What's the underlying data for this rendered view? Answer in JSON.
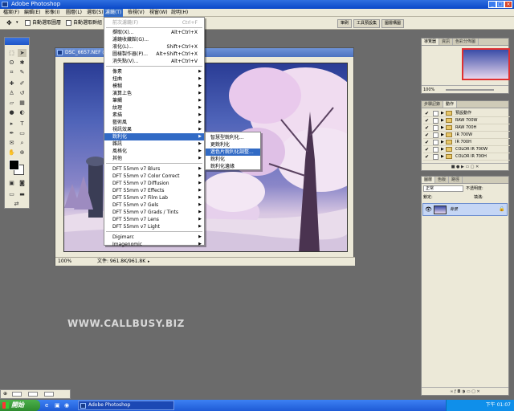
{
  "window": {
    "title": "Adobe Photoshop",
    "min_icon": "minimize-icon",
    "max_icon": "maximize-icon",
    "close_icon": "close-icon"
  },
  "menubar": {
    "items": [
      "檔案(F)",
      "編輯(E)",
      "影像(I)",
      "圖層(L)",
      "選取(S)",
      "濾鏡(T)",
      "檢視(V)",
      "視窗(W)",
      "說明(H)"
    ],
    "active_index": 5
  },
  "options": {
    "auto_select_layer": "自動選取圖層",
    "auto_select_group": "自動選取群組",
    "tabs": [
      "筆刷",
      "工具預設集",
      "圖層構圖"
    ]
  },
  "document": {
    "title": "DSC_6657.NEF @",
    "zoom": "100%",
    "file_info": "文件: 961.8K/961.8K"
  },
  "filter_menu": {
    "items": [
      {
        "label": "前次濾鏡(F)",
        "shortcut": "Ctrl+F",
        "disabled": true,
        "arrow": false
      },
      {
        "label": "擷取(X)...",
        "shortcut": "Alt+Ctrl+X",
        "disabled": false,
        "arrow": false
      },
      {
        "label": "濾鏡收藏館(G)...",
        "shortcut": "",
        "disabled": false,
        "arrow": false
      },
      {
        "label": "液化(L)...",
        "shortcut": "Shift+Ctrl+X",
        "disabled": false,
        "arrow": false
      },
      {
        "label": "圖樣製作器(P)...",
        "shortcut": "Alt+Shift+Ctrl+X",
        "disabled": false,
        "arrow": false
      },
      {
        "label": "消失點(V)...",
        "shortcut": "Alt+Ctrl+V",
        "disabled": false,
        "arrow": false
      },
      {
        "label": "像素",
        "shortcut": "",
        "disabled": false,
        "arrow": true
      },
      {
        "label": "扭曲",
        "shortcut": "",
        "disabled": false,
        "arrow": true
      },
      {
        "label": "模糊",
        "shortcut": "",
        "disabled": false,
        "arrow": true
      },
      {
        "label": "演算上色",
        "shortcut": "",
        "disabled": false,
        "arrow": true
      },
      {
        "label": "筆觸",
        "shortcut": "",
        "disabled": false,
        "arrow": true
      },
      {
        "label": "紋理",
        "shortcut": "",
        "disabled": false,
        "arrow": true
      },
      {
        "label": "素描",
        "shortcut": "",
        "disabled": false,
        "arrow": true
      },
      {
        "label": "藝術風",
        "shortcut": "",
        "disabled": false,
        "arrow": true
      },
      {
        "label": "視訊效果",
        "shortcut": "",
        "disabled": false,
        "arrow": true
      },
      {
        "label": "銳利化",
        "shortcut": "",
        "disabled": false,
        "arrow": true,
        "highlighted": true
      },
      {
        "label": "雜訊",
        "shortcut": "",
        "disabled": false,
        "arrow": true
      },
      {
        "label": "風格化",
        "shortcut": "",
        "disabled": false,
        "arrow": true
      },
      {
        "label": "其他",
        "shortcut": "",
        "disabled": false,
        "arrow": true
      },
      {
        "label": "DFT 55mm v7 Blurs",
        "shortcut": "",
        "disabled": false,
        "arrow": true
      },
      {
        "label": "DFT 55mm v7 Color Correct",
        "shortcut": "",
        "disabled": false,
        "arrow": true
      },
      {
        "label": "DFT 55mm v7 Diffusion",
        "shortcut": "",
        "disabled": false,
        "arrow": true
      },
      {
        "label": "DFT 55mm v7 Effects",
        "shortcut": "",
        "disabled": false,
        "arrow": true
      },
      {
        "label": "DFT 55mm v7 Film Lab",
        "shortcut": "",
        "disabled": false,
        "arrow": true
      },
      {
        "label": "DFT 55mm v7 Gels",
        "shortcut": "",
        "disabled": false,
        "arrow": true
      },
      {
        "label": "DFT 55mm v7 Grads / Tints",
        "shortcut": "",
        "disabled": false,
        "arrow": true
      },
      {
        "label": "DFT 55mm v7 Lens",
        "shortcut": "",
        "disabled": false,
        "arrow": true
      },
      {
        "label": "DFT 55mm v7 Light",
        "shortcut": "",
        "disabled": false,
        "arrow": true
      },
      {
        "label": "Digimarc",
        "shortcut": "",
        "disabled": false,
        "arrow": true
      },
      {
        "label": "Imagenomic",
        "shortcut": "",
        "disabled": false,
        "arrow": true
      }
    ]
  },
  "sharpen_submenu": {
    "items": [
      {
        "label": "智慧型銳利化...",
        "highlighted": false
      },
      {
        "label": "更銳利化",
        "highlighted": false
      },
      {
        "label": "遮色片銳利化調整...",
        "highlighted": true
      },
      {
        "label": "銳利化",
        "highlighted": false
      },
      {
        "label": "銳利化邊緣",
        "highlighted": false
      }
    ]
  },
  "navigator_panel": {
    "tabs": [
      "導覽器",
      "資訊",
      "色彩分佈圖"
    ],
    "zoom": "100%"
  },
  "actions_panel": {
    "tabs": [
      "步驟記錄",
      "動作"
    ],
    "rows": [
      "預設動作",
      "RAW 700W",
      "RAW 700H",
      "IR 700W",
      "IR 700H",
      "COLOR IR 700W",
      "COLOR IR 700H"
    ]
  },
  "layers_panel": {
    "tabs": [
      "圖層",
      "色版",
      "路徑"
    ],
    "blend_mode": "正常",
    "opacity_label": "不透明度:",
    "lock_label": "鎖定:",
    "fill_label": "填滿:",
    "layer_name": "背景"
  },
  "watermark": "WWW.CALLBUSY.BIZ",
  "taskbar": {
    "start": "開始",
    "task": "Adobe Photoshop",
    "clock": "下午 01:07"
  },
  "appstatus": {
    "zoom": "⊕"
  },
  "colors": {
    "menu_highlight": "#316ac5",
    "xp_blue": "#245edb",
    "workspace": "#6b6b6b"
  }
}
